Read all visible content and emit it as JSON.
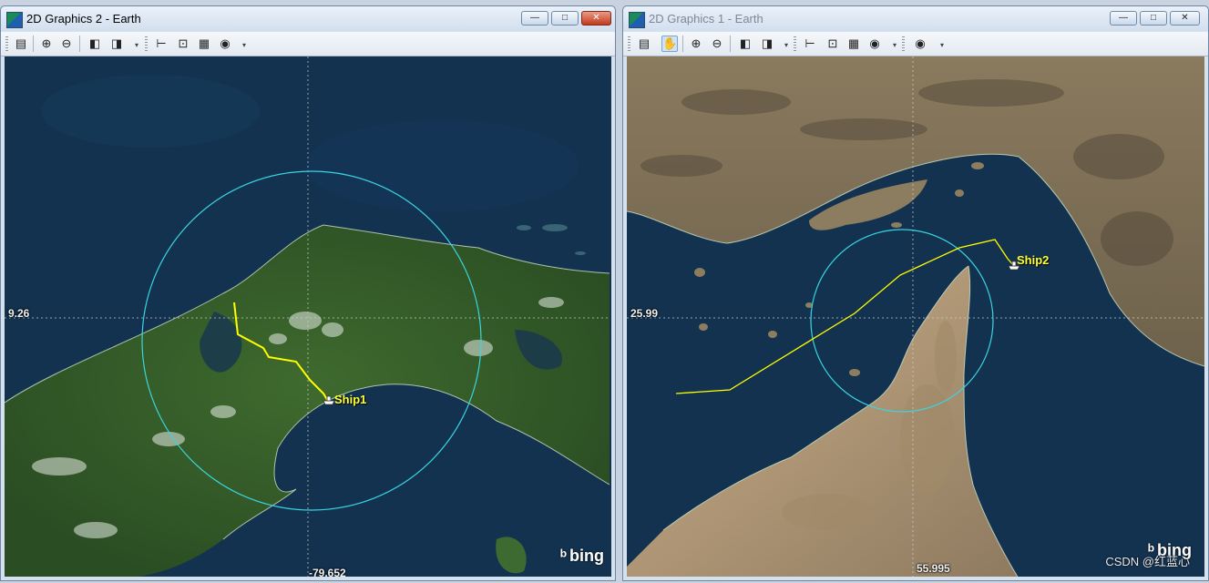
{
  "windows": {
    "left": {
      "title": "2D Graphics 2 - Earth",
      "lat_readout": "9.26",
      "lon_readout": "-79.652",
      "ship_label": "Ship1",
      "attribution": "bing"
    },
    "right": {
      "title": "2D Graphics 1 - Earth",
      "lat_readout": "25.99",
      "lon_readout": "55.995",
      "ship_label": "Ship2",
      "attribution": "bing"
    }
  },
  "window_controls": {
    "minimize": "—",
    "maximize": "□",
    "close": "✕"
  },
  "toolbar_icons": {
    "properties": "▤",
    "pan": "✋",
    "zoom_in": "⊕",
    "zoom_out": "⊖",
    "save_image": "◧",
    "snapshot": "◨",
    "measure": "⊢",
    "scale": "⊡",
    "graphics": "▦",
    "globe": "◉",
    "dropdown": "▾"
  },
  "colors": {
    "range_circle": "#39d6e0",
    "route": "#ffff00",
    "ship_label": "#ffff33",
    "ocean": "#13324f"
  },
  "watermark": "CSDN @红蓝心"
}
